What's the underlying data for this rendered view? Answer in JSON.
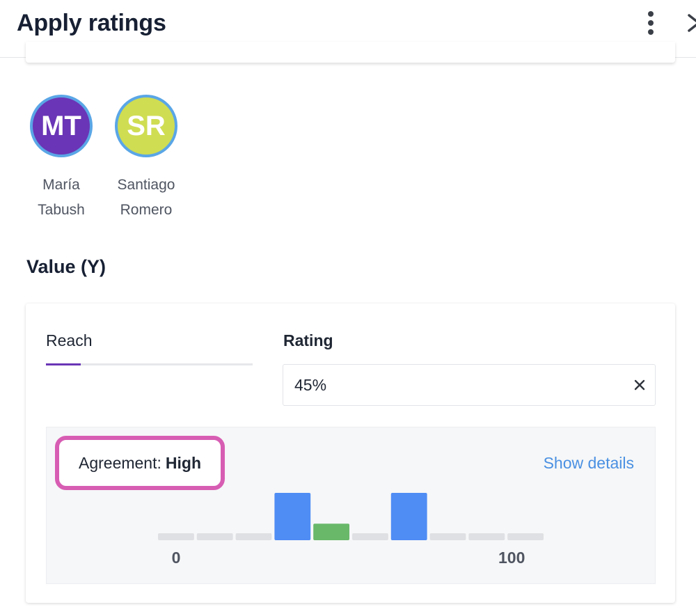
{
  "header": {
    "title": "Apply ratings",
    "menu_icon": "kebab-menu-icon",
    "close_icon": "close-icon"
  },
  "raters": [
    {
      "initials": "MT",
      "first": "María",
      "last": "Tabush",
      "color": "#6a35b6"
    },
    {
      "initials": "SR",
      "first": "Santiago",
      "last": "Romero",
      "color": "#cfdd52"
    }
  ],
  "value_section": {
    "title": "Value (Y)",
    "reach_label": "Reach",
    "reach_progress": 0.17,
    "rating_label": "Rating",
    "rating_value": "45%",
    "agreement_label": "Agreement:",
    "agreement_value": "High",
    "show_details": "Show details"
  },
  "chart_data": {
    "type": "bar",
    "bins": 10,
    "values": [
      0,
      0,
      0,
      1,
      0.35,
      0,
      1,
      0,
      0,
      0
    ],
    "highlight_bin": 4,
    "colors": {
      "empty": "#dfe0e3",
      "rater": "#4f8cf4",
      "consensus": "#69b86a"
    },
    "x_range_labels": [
      "0",
      "100"
    ]
  }
}
